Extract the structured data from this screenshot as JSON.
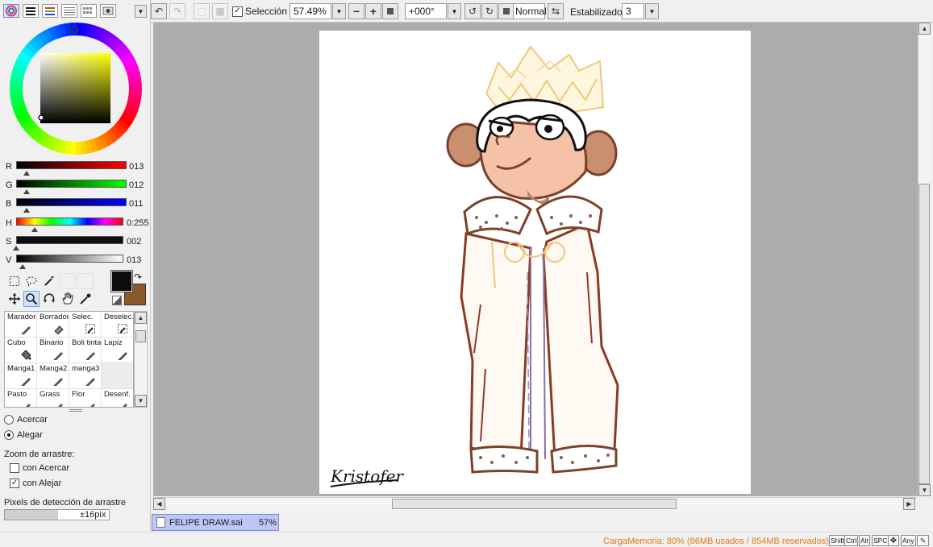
{
  "toolbar": {
    "selection_label": "Selección",
    "selection_checked": true,
    "zoom_value": "57.49%",
    "rotation_value": "+000°",
    "blend_mode": "Normal",
    "stabilizer_label": "Estabilizador",
    "stabilizer_value": "3"
  },
  "color": {
    "r_label": "R",
    "r_value": "013",
    "g_label": "G",
    "g_value": "012",
    "b_label": "B",
    "b_value": "011",
    "h_label": "H",
    "h_value": "0:255",
    "s_label": "S",
    "s_value": "002",
    "v_label": "V",
    "v_value": "013",
    "primary": "#0d0c0b",
    "secondary": "#8b5a2b"
  },
  "brushes": [
    {
      "name": "Marador",
      "icon": "marker-icon"
    },
    {
      "name": "Borrador",
      "icon": "eraser-icon"
    },
    {
      "name": "Selec.",
      "icon": "select-brush-icon"
    },
    {
      "name": "Deselec.",
      "icon": "deselect-brush-icon"
    },
    {
      "name": "Cubo",
      "icon": "bucket-icon"
    },
    {
      "name": "Binario",
      "icon": "binary-pen-icon"
    },
    {
      "name": "Boli tinta",
      "icon": "ink-pen-icon"
    },
    {
      "name": "Lapiz",
      "icon": "pencil-icon"
    },
    {
      "name": "Manga1",
      "icon": "pen-icon"
    },
    {
      "name": "Manga2",
      "icon": "pen-icon"
    },
    {
      "name": "manga3",
      "icon": "pen-icon"
    },
    {
      "name": "",
      "icon": ""
    },
    {
      "name": "Pasto",
      "icon": "pen-icon"
    },
    {
      "name": "Grass",
      "icon": "pen-icon"
    },
    {
      "name": "Flor",
      "icon": "pen-icon"
    },
    {
      "name": "Desenf.",
      "icon": "pen-icon"
    }
  ],
  "zoom_options": {
    "zoom_in_label": "Acercar",
    "zoom_out_label": "Alegar",
    "drag_zoom_label": "Zoom de arrastre:",
    "with_zoom_in_label": "con Acercar",
    "with_zoom_out_label": "con Alejar",
    "drag_pixels_label": "Pixels de detección de arrastre",
    "drag_pixels_value": "±16pix"
  },
  "canvas": {
    "signature": "Kristofer"
  },
  "document_tab": {
    "name": "FELIPE DRAW.sai",
    "zoom": "57%"
  },
  "status": {
    "memory": "CargaMemoria: 80% (86MB usados / 854MB reservados)",
    "keys": [
      "Shift",
      "Ctrl",
      "Alt",
      "SPC",
      "Any"
    ]
  }
}
